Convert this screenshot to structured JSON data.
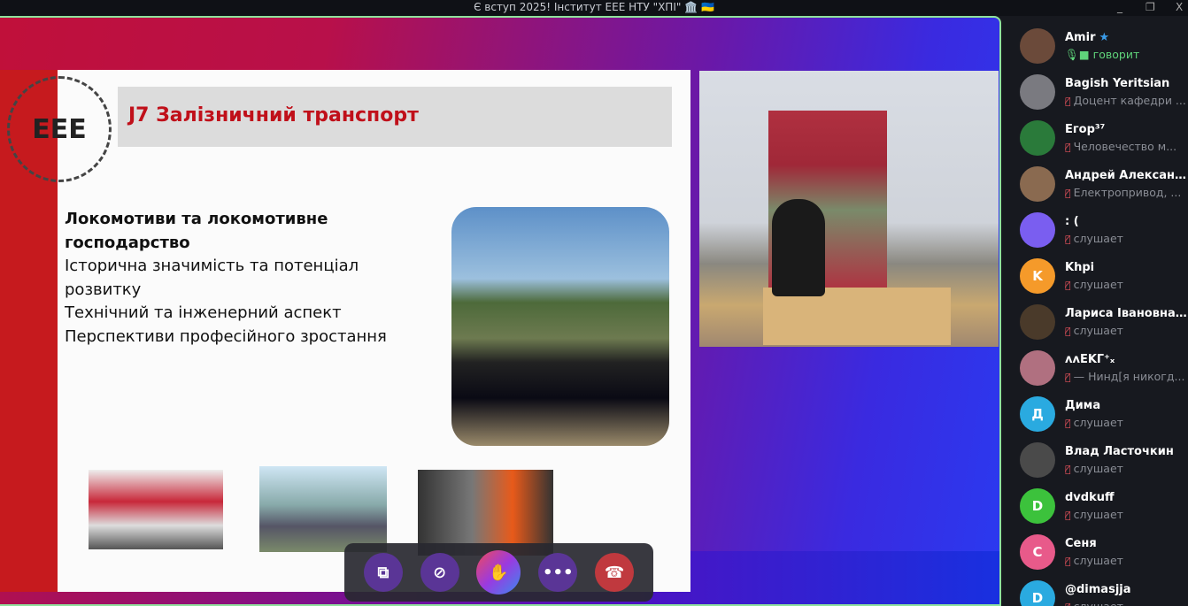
{
  "window": {
    "title": "Є вступ 2025! Інститут ЕЕЕ НТУ \"ХПІ\" 🏛️ 🇺🇦",
    "minimize": "_",
    "maximize": "❐",
    "close": "X"
  },
  "slide": {
    "logo": "EEE",
    "header": "J7 Залізничний транспорт",
    "lines": [
      {
        "text": "Локомотиви та локомотивне господарство",
        "bold": true
      },
      {
        "text": "Історична значимість та потенціал розвитку",
        "bold": false
      },
      {
        "text": "Технічний та інженерний аспект",
        "bold": false
      },
      {
        "text": "Перспективи професійного зростання",
        "bold": false
      }
    ]
  },
  "controls": {
    "share": "screen-share-icon",
    "video": "video-off-icon",
    "raise": "raise-hand-icon",
    "more": "•••",
    "leave": "end-call-icon"
  },
  "participants": [
    {
      "name": "Amir",
      "status": "говорит",
      "initial": "",
      "color": "#6b4a3a",
      "speaking": true,
      "star": "★"
    },
    {
      "name": "Bagish Yeritsian",
      "status": "Доцент кафедри ...",
      "initial": "",
      "color": "#7a7a80"
    },
    {
      "name": "Егор³⁷",
      "status": "Человечество м...",
      "initial": "",
      "color": "#2a7a3a"
    },
    {
      "name": "Андрей Александ...",
      "status": "Електропривод, ...",
      "initial": "",
      "color": "#8a6a50"
    },
    {
      "name": ": (",
      "status": "слушает",
      "initial": "",
      "color": "#7a5ef0"
    },
    {
      "name": "Khpi",
      "status": "слушает",
      "initial": "K",
      "color": "#f59a2a"
    },
    {
      "name": "Лариса Івановна ...",
      "status": "слушает",
      "initial": "",
      "color": "#4a3a2a"
    },
    {
      "name": "ᴧᴧEKᒥ⁺ₓ",
      "status": "— Нинд[я никогд...",
      "initial": "",
      "color": "#b07080"
    },
    {
      "name": "Дима",
      "status": "слушает",
      "initial": "Д",
      "color": "#2aaae0"
    },
    {
      "name": "Влад Ласточкин",
      "status": "слушает",
      "initial": "",
      "color": "#4a4a4a"
    },
    {
      "name": "dvdkuff",
      "status": "слушает",
      "initial": "D",
      "color": "#3cc23c"
    },
    {
      "name": "Сеня",
      "status": "слушает",
      "initial": "С",
      "color": "#e85a8a"
    },
    {
      "name": "@dimasjja",
      "status": "слушает",
      "initial": "D",
      "color": "#2aaae0"
    }
  ]
}
